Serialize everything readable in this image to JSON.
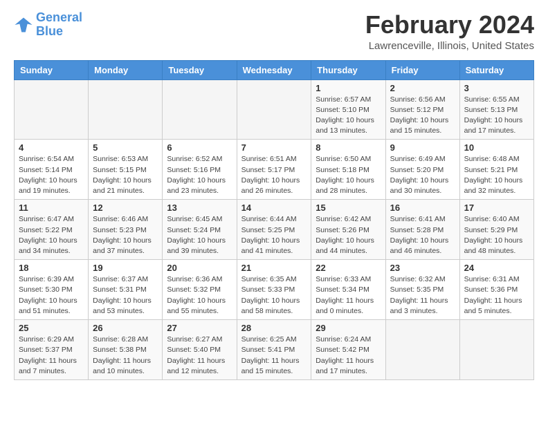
{
  "logo": {
    "line1": "General",
    "line2": "Blue"
  },
  "title": "February 2024",
  "location": "Lawrenceville, Illinois, United States",
  "weekdays": [
    "Sunday",
    "Monday",
    "Tuesday",
    "Wednesday",
    "Thursday",
    "Friday",
    "Saturday"
  ],
  "weeks": [
    [
      {
        "day": "",
        "info": ""
      },
      {
        "day": "",
        "info": ""
      },
      {
        "day": "",
        "info": ""
      },
      {
        "day": "",
        "info": ""
      },
      {
        "day": "1",
        "info": "Sunrise: 6:57 AM\nSunset: 5:10 PM\nDaylight: 10 hours\nand 13 minutes."
      },
      {
        "day": "2",
        "info": "Sunrise: 6:56 AM\nSunset: 5:12 PM\nDaylight: 10 hours\nand 15 minutes."
      },
      {
        "day": "3",
        "info": "Sunrise: 6:55 AM\nSunset: 5:13 PM\nDaylight: 10 hours\nand 17 minutes."
      }
    ],
    [
      {
        "day": "4",
        "info": "Sunrise: 6:54 AM\nSunset: 5:14 PM\nDaylight: 10 hours\nand 19 minutes."
      },
      {
        "day": "5",
        "info": "Sunrise: 6:53 AM\nSunset: 5:15 PM\nDaylight: 10 hours\nand 21 minutes."
      },
      {
        "day": "6",
        "info": "Sunrise: 6:52 AM\nSunset: 5:16 PM\nDaylight: 10 hours\nand 23 minutes."
      },
      {
        "day": "7",
        "info": "Sunrise: 6:51 AM\nSunset: 5:17 PM\nDaylight: 10 hours\nand 26 minutes."
      },
      {
        "day": "8",
        "info": "Sunrise: 6:50 AM\nSunset: 5:18 PM\nDaylight: 10 hours\nand 28 minutes."
      },
      {
        "day": "9",
        "info": "Sunrise: 6:49 AM\nSunset: 5:20 PM\nDaylight: 10 hours\nand 30 minutes."
      },
      {
        "day": "10",
        "info": "Sunrise: 6:48 AM\nSunset: 5:21 PM\nDaylight: 10 hours\nand 32 minutes."
      }
    ],
    [
      {
        "day": "11",
        "info": "Sunrise: 6:47 AM\nSunset: 5:22 PM\nDaylight: 10 hours\nand 34 minutes."
      },
      {
        "day": "12",
        "info": "Sunrise: 6:46 AM\nSunset: 5:23 PM\nDaylight: 10 hours\nand 37 minutes."
      },
      {
        "day": "13",
        "info": "Sunrise: 6:45 AM\nSunset: 5:24 PM\nDaylight: 10 hours\nand 39 minutes."
      },
      {
        "day": "14",
        "info": "Sunrise: 6:44 AM\nSunset: 5:25 PM\nDaylight: 10 hours\nand 41 minutes."
      },
      {
        "day": "15",
        "info": "Sunrise: 6:42 AM\nSunset: 5:26 PM\nDaylight: 10 hours\nand 44 minutes."
      },
      {
        "day": "16",
        "info": "Sunrise: 6:41 AM\nSunset: 5:28 PM\nDaylight: 10 hours\nand 46 minutes."
      },
      {
        "day": "17",
        "info": "Sunrise: 6:40 AM\nSunset: 5:29 PM\nDaylight: 10 hours\nand 48 minutes."
      }
    ],
    [
      {
        "day": "18",
        "info": "Sunrise: 6:39 AM\nSunset: 5:30 PM\nDaylight: 10 hours\nand 51 minutes."
      },
      {
        "day": "19",
        "info": "Sunrise: 6:37 AM\nSunset: 5:31 PM\nDaylight: 10 hours\nand 53 minutes."
      },
      {
        "day": "20",
        "info": "Sunrise: 6:36 AM\nSunset: 5:32 PM\nDaylight: 10 hours\nand 55 minutes."
      },
      {
        "day": "21",
        "info": "Sunrise: 6:35 AM\nSunset: 5:33 PM\nDaylight: 10 hours\nand 58 minutes."
      },
      {
        "day": "22",
        "info": "Sunrise: 6:33 AM\nSunset: 5:34 PM\nDaylight: 11 hours\nand 0 minutes."
      },
      {
        "day": "23",
        "info": "Sunrise: 6:32 AM\nSunset: 5:35 PM\nDaylight: 11 hours\nand 3 minutes."
      },
      {
        "day": "24",
        "info": "Sunrise: 6:31 AM\nSunset: 5:36 PM\nDaylight: 11 hours\nand 5 minutes."
      }
    ],
    [
      {
        "day": "25",
        "info": "Sunrise: 6:29 AM\nSunset: 5:37 PM\nDaylight: 11 hours\nand 7 minutes."
      },
      {
        "day": "26",
        "info": "Sunrise: 6:28 AM\nSunset: 5:38 PM\nDaylight: 11 hours\nand 10 minutes."
      },
      {
        "day": "27",
        "info": "Sunrise: 6:27 AM\nSunset: 5:40 PM\nDaylight: 11 hours\nand 12 minutes."
      },
      {
        "day": "28",
        "info": "Sunrise: 6:25 AM\nSunset: 5:41 PM\nDaylight: 11 hours\nand 15 minutes."
      },
      {
        "day": "29",
        "info": "Sunrise: 6:24 AM\nSunset: 5:42 PM\nDaylight: 11 hours\nand 17 minutes."
      },
      {
        "day": "",
        "info": ""
      },
      {
        "day": "",
        "info": ""
      }
    ]
  ]
}
